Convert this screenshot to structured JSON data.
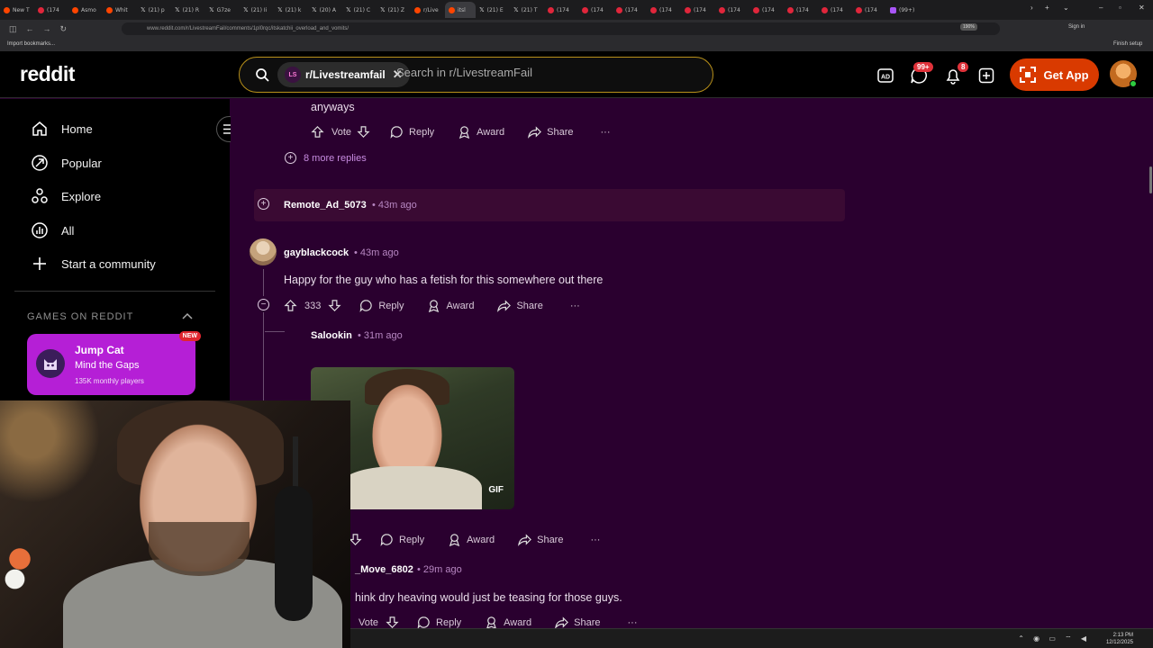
{
  "browser": {
    "tabs": [
      {
        "label": "New T",
        "icon": "reddit"
      },
      {
        "label": "(174",
        "icon": "youtube"
      },
      {
        "label": "Asmo",
        "icon": "reddit"
      },
      {
        "label": "Whit",
        "icon": "reddit"
      },
      {
        "label": "(21) p",
        "icon": "x"
      },
      {
        "label": "(21) R",
        "icon": "x"
      },
      {
        "label": "G7ze",
        "icon": "x"
      },
      {
        "label": "(21) Ii",
        "icon": "x"
      },
      {
        "label": "(21) k",
        "icon": "x"
      },
      {
        "label": "(20) A",
        "icon": "x"
      },
      {
        "label": "(21) C",
        "icon": "x"
      },
      {
        "label": "(21) Z",
        "icon": "x"
      },
      {
        "label": "r/Live",
        "icon": "reddit"
      },
      {
        "label": "itsl",
        "icon": "reddit",
        "active": true
      },
      {
        "label": "(21) E",
        "icon": "x"
      },
      {
        "label": "(21) T",
        "icon": "x"
      },
      {
        "label": "(174",
        "icon": "youtube"
      },
      {
        "label": "(174",
        "icon": "youtube"
      },
      {
        "label": "(174",
        "icon": "youtube"
      },
      {
        "label": "(174",
        "icon": "youtube"
      },
      {
        "label": "(174",
        "icon": "youtube"
      },
      {
        "label": "(174",
        "icon": "youtube"
      },
      {
        "label": "(174",
        "icon": "youtube"
      },
      {
        "label": "(174",
        "icon": "youtube"
      },
      {
        "label": "(174",
        "icon": "youtube"
      },
      {
        "label": "(174",
        "icon": "youtube"
      },
      {
        "label": "(99+)",
        "icon": "purple"
      }
    ],
    "url": "www.reddit.com/r/LivestreamFail/comments/1pl0rqc/itskatchii_overload_and_vomits/",
    "zoom": "190%",
    "signin": "Sign in",
    "bookmarks_import": "Import bookmarks...",
    "finish_setup": "Finish setup"
  },
  "header": {
    "logo": "reddit",
    "subreddit_chip": "r/Livestreamfail",
    "subreddit_icon_text": "LS",
    "search_placeholder": "Search in r/LivestreamFail",
    "chat_badge": "99+",
    "notif_badge": "8",
    "get_app": "Get App"
  },
  "sidebar": {
    "items": [
      {
        "label": "Home",
        "icon": "home-icon"
      },
      {
        "label": "Popular",
        "icon": "popular-icon"
      },
      {
        "label": "Explore",
        "icon": "explore-icon"
      },
      {
        "label": "All",
        "icon": "all-icon"
      },
      {
        "label": "Start a community",
        "icon": "plus-icon"
      }
    ],
    "games_header": "GAMES ON REDDIT",
    "game": {
      "name": "Jump Cat",
      "tagline": "Mind the Gaps",
      "players": "135K monthly players",
      "badge": "NEW"
    }
  },
  "comments": {
    "top_fragment": {
      "text": "anyways",
      "vote_label": "Vote",
      "more_replies": "8 more replies"
    },
    "collapsed": {
      "author": "Remote_Ad_5073",
      "time": "• 43m ago"
    },
    "main": {
      "author": "gayblackcock",
      "time": "• 43m ago",
      "text": "Happy for the guy who has a fetish for this somewhere out there",
      "score": "333"
    },
    "reply1": {
      "author": "Salookin",
      "time": "• 31m ago",
      "gif_label": "GIF"
    },
    "reply2": {
      "author": "_Move_6802",
      "time": "• 29m ago",
      "text": "hink dry heaving would just be teasing for those guys.",
      "vote_label": "Vote"
    },
    "actions": {
      "reply": "Reply",
      "award": "Award",
      "share": "Share",
      "more": "···"
    }
  },
  "taskbar": {
    "time": "2:13 PM",
    "date": "12/12/2025"
  },
  "colors": {
    "background": "#2a002f",
    "get_app": "#d93a00",
    "game_card": "#b51fd6",
    "badge": "#e0323a"
  }
}
